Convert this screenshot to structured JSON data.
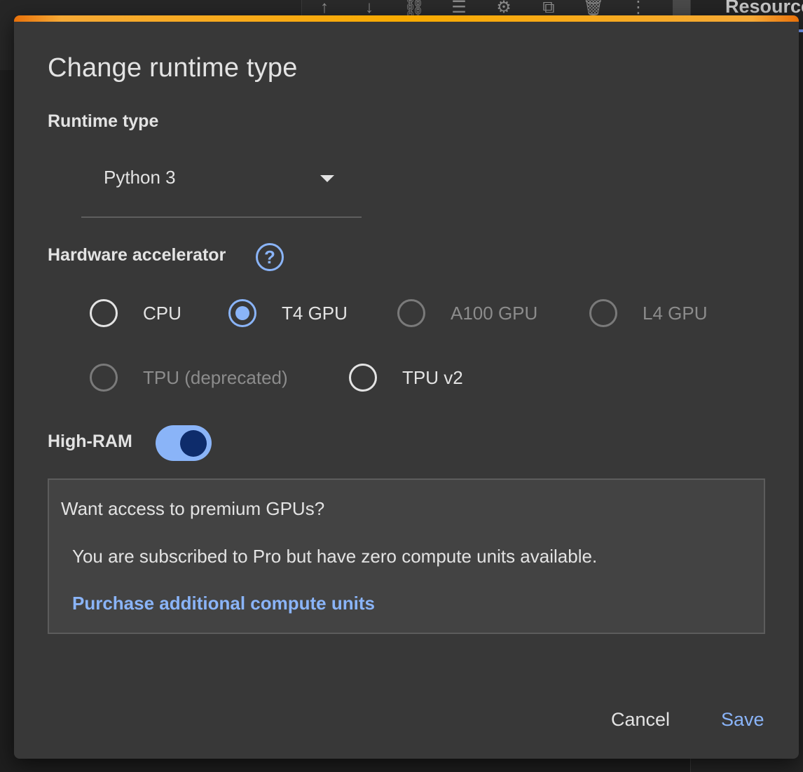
{
  "background": {
    "right_panel_title": "Resources",
    "toolbar_icons": [
      "arrow-up-icon",
      "arrow-down-icon",
      "link-icon",
      "comment-icon",
      "settings-icon",
      "mirror-icon",
      "delete-icon",
      "more-vert-icon"
    ]
  },
  "dialog": {
    "title": "Change runtime type",
    "runtime_type": {
      "label": "Runtime type",
      "selected_value": "Python 3"
    },
    "hardware_accelerator": {
      "label": "Hardware accelerator",
      "help_glyph": "?",
      "options": [
        {
          "label": "CPU",
          "checked": false,
          "disabled": false
        },
        {
          "label": "T4 GPU",
          "checked": true,
          "disabled": false
        },
        {
          "label": "A100 GPU",
          "checked": false,
          "disabled": true
        },
        {
          "label": "L4 GPU",
          "checked": false,
          "disabled": true
        },
        {
          "label": "TPU (deprecated)",
          "checked": false,
          "disabled": true
        },
        {
          "label": "TPU v2",
          "checked": false,
          "disabled": false
        }
      ]
    },
    "high_ram": {
      "label": "High-RAM",
      "enabled": true
    },
    "premium_box": {
      "title": "Want access to premium GPUs?",
      "message": "You are subscribed to Pro but have zero compute units available.",
      "link": "Purchase additional compute units"
    },
    "buttons": {
      "cancel": "Cancel",
      "save": "Save"
    }
  },
  "colors": {
    "accent": "#8ab4f8",
    "dialog_bg": "#383838",
    "top_stripe": "#f9ab00"
  }
}
